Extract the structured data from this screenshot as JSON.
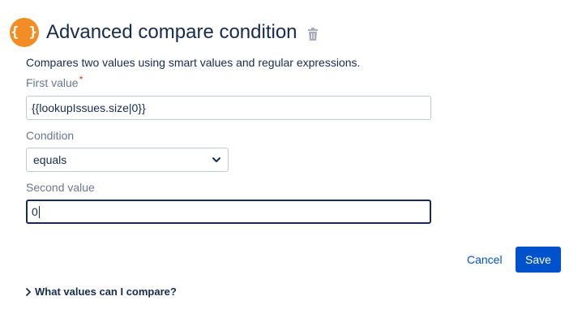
{
  "header": {
    "icon_glyph": "{ }",
    "icon_color": "#f18d24",
    "title": "Advanced compare condition",
    "delete_icon": "trash-icon"
  },
  "description": "Compares two values using smart values and regular expressions.",
  "form": {
    "first_value": {
      "label": "First value",
      "required_marker": "*",
      "value": "{{lookupIssues.size|0}}"
    },
    "condition": {
      "label": "Condition",
      "selected": "equals"
    },
    "second_value": {
      "label": "Second value",
      "value": "0"
    }
  },
  "actions": {
    "cancel_label": "Cancel",
    "save_label": "Save",
    "primary_color": "#0052cc"
  },
  "help": {
    "expander_label": "What values can I compare?"
  }
}
